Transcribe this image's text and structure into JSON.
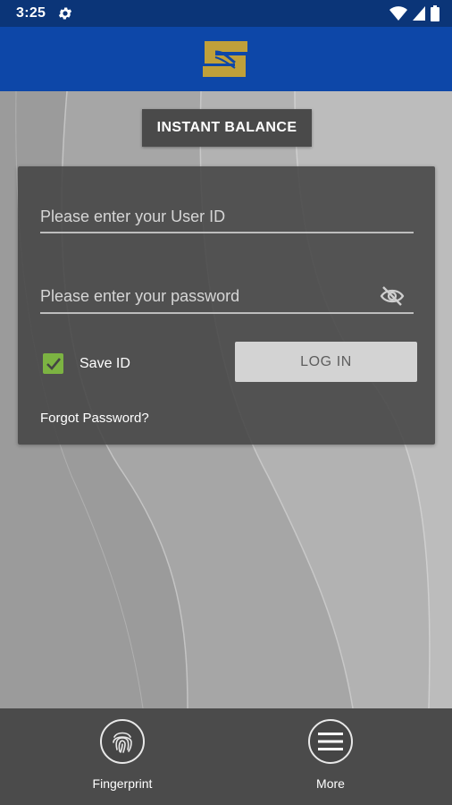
{
  "status_bar": {
    "time": "3:25",
    "icons": [
      "gear-icon",
      "wifi-icon",
      "signal-icon",
      "battery-icon"
    ]
  },
  "app_bar": {
    "logo": "s-logo",
    "colors": {
      "background": "#0d47a8",
      "logo": "#bfa03a"
    }
  },
  "instant_balance": {
    "label": "INSTANT BALANCE"
  },
  "login": {
    "userid_placeholder": "Please enter your User ID",
    "password_placeholder": "Please enter your password",
    "save_id_label": "Save ID",
    "save_id_checked": true,
    "login_label": "LOG IN",
    "forgot_label": "Forgot Password?"
  },
  "bottom_nav": {
    "fingerprint_label": "Fingerprint",
    "more_label": "More"
  },
  "colors": {
    "status_bar": "#0b3578",
    "checkbox": "#7cb342",
    "card": "#444444",
    "login_button": "#d3d3d3"
  }
}
